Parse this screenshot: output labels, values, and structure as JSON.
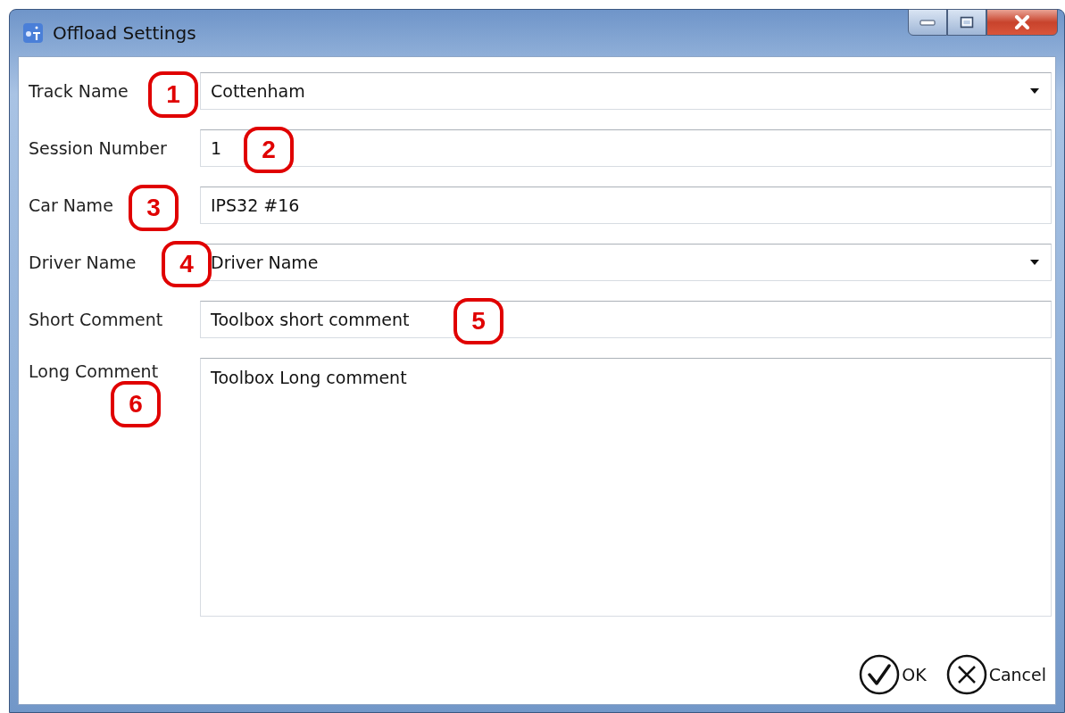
{
  "window": {
    "title": "Offload Settings"
  },
  "fields": [
    {
      "label": "Track Name",
      "kind": "dropdown",
      "value": "Cottenham",
      "callout": "1"
    },
    {
      "label": "Session Number",
      "kind": "text",
      "value": "1",
      "callout": "2"
    },
    {
      "label": "Car Name",
      "kind": "text",
      "value": "IPS32 #16",
      "callout": "3"
    },
    {
      "label": "Driver Name",
      "kind": "dropdown",
      "value": "Driver Name",
      "callout": "4"
    },
    {
      "label": "Short Comment",
      "kind": "text",
      "value": "Toolbox short comment",
      "callout": "5"
    },
    {
      "label": "Long Comment",
      "kind": "textarea",
      "value": "Toolbox Long comment",
      "callout": "6"
    }
  ],
  "buttons": [
    {
      "label": "OK",
      "kind": "ok"
    },
    {
      "label": "Cancel",
      "kind": "cancel"
    }
  ]
}
